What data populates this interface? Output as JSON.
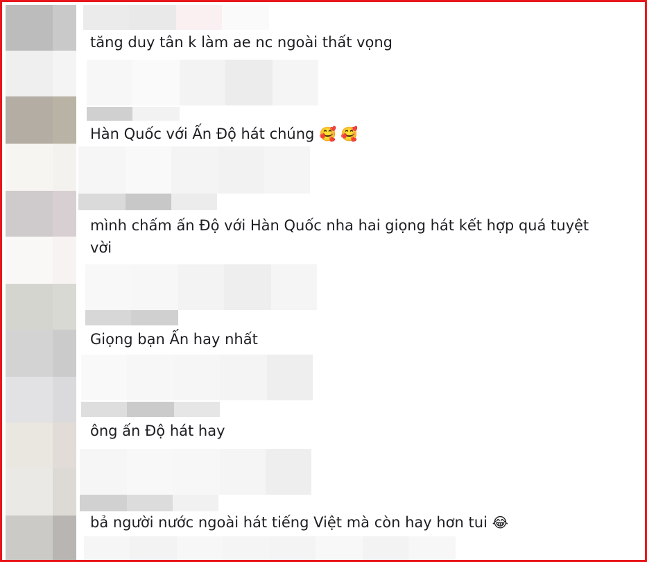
{
  "comments": [
    {
      "text": "tăng duy tân k làm ae nc ngoài thất vọng"
    },
    {
      "text": "Hàn Quốc với Ấn Độ hát chúng",
      "emoji": "🥰 🥰"
    },
    {
      "text": "mình chấm ấn Độ với Hàn Quốc nha hai giọng hát kết hợp quá tuyệt vời"
    },
    {
      "text": "Giọng bạn Ấn hay nhất"
    },
    {
      "text": "ông ấn Độ hát hay"
    },
    {
      "text": "bả người nước ngoài hát tiếng Việt mà còn hay hơn tui",
      "emoji": "😂"
    }
  ],
  "colors": {
    "border": "#e8161b",
    "text": "#1c1e21"
  }
}
